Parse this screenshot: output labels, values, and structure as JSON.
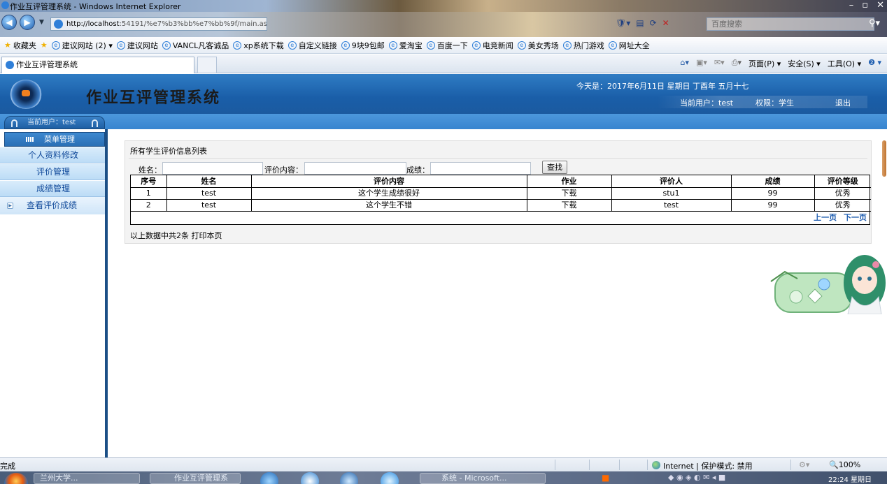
{
  "browser": {
    "window_title": "作业互评管理系统 - Windows Internet Explorer",
    "address_url": "http://localhost:54191/%e7%b3%bb%e7%bb%9f/main.aspx",
    "address_host": "http://localhost",
    "address_path": ":54191/%e7%b3%bb%e7%bb%9f/main.aspx",
    "search_placeholder": "百度搜索",
    "favorites_label": "收藏夹",
    "favorites": [
      {
        "label": "建议网站 (2) ▾"
      },
      {
        "label": "建议网站"
      },
      {
        "label": "VANCL凡客诚品"
      },
      {
        "label": "xp系统下载"
      },
      {
        "label": "自定义链接"
      },
      {
        "label": "9块9包邮"
      },
      {
        "label": "爱淘宝"
      },
      {
        "label": "百度一下"
      },
      {
        "label": "电竞新闻"
      },
      {
        "label": "美女秀场"
      },
      {
        "label": "热门游戏"
      },
      {
        "label": "网址大全"
      }
    ],
    "tab_title": "作业互评管理系统",
    "command_bar": {
      "page": "页面(P) ▾",
      "safety": "安全(S) ▾",
      "tools": "工具(O) ▾",
      "help": "❷ ▾"
    },
    "status": {
      "done": "完成",
      "zone": "Internet | 保护模式: 禁用",
      "zoom": "🔍100%"
    }
  },
  "app": {
    "title": "作业互评管理系统",
    "today_text": "今天是：2017年6月11日 星期日 丁酉年 五月十七",
    "current_user_label": "当前用户：test",
    "role_label": "权限：学生",
    "logout_label": "退出",
    "sidebar_user_tab": "当前用户：test",
    "menu_header": "菜单管理",
    "menu_items": [
      {
        "label": "个人资料修改"
      },
      {
        "label": "评价管理"
      },
      {
        "label": "成绩管理"
      }
    ],
    "menu_view": "查看评价成绩"
  },
  "panel": {
    "title": "所有学生评价信息列表",
    "filters": {
      "name_label": "姓名：",
      "name_value": "",
      "content_label": "评价内容：",
      "content_value": "",
      "score_label": "成绩：",
      "score_value": "",
      "search_button": "查找"
    },
    "table": {
      "headers": [
        "序号",
        "姓名",
        "评价内容",
        "作业",
        "评价人",
        "成绩",
        "评价等级"
      ],
      "rows": [
        [
          "1",
          "test",
          "这个学生成绩很好",
          "下载",
          "stu1",
          "99",
          "优秀"
        ],
        [
          "2",
          "test",
          "这个学生不错",
          "下载",
          "test",
          "99",
          "优秀"
        ]
      ]
    },
    "pager": {
      "prev": "上一页",
      "next": "下一页"
    },
    "summary": "以上数据中共2条 打印本页"
  },
  "taskbar": {
    "buttons": [
      {
        "label": "兰州大学..."
      },
      {
        "label": "作业互评管理系"
      },
      {
        "label": "系统 - Microsoft..."
      }
    ],
    "clock": "22:24 星期日"
  }
}
